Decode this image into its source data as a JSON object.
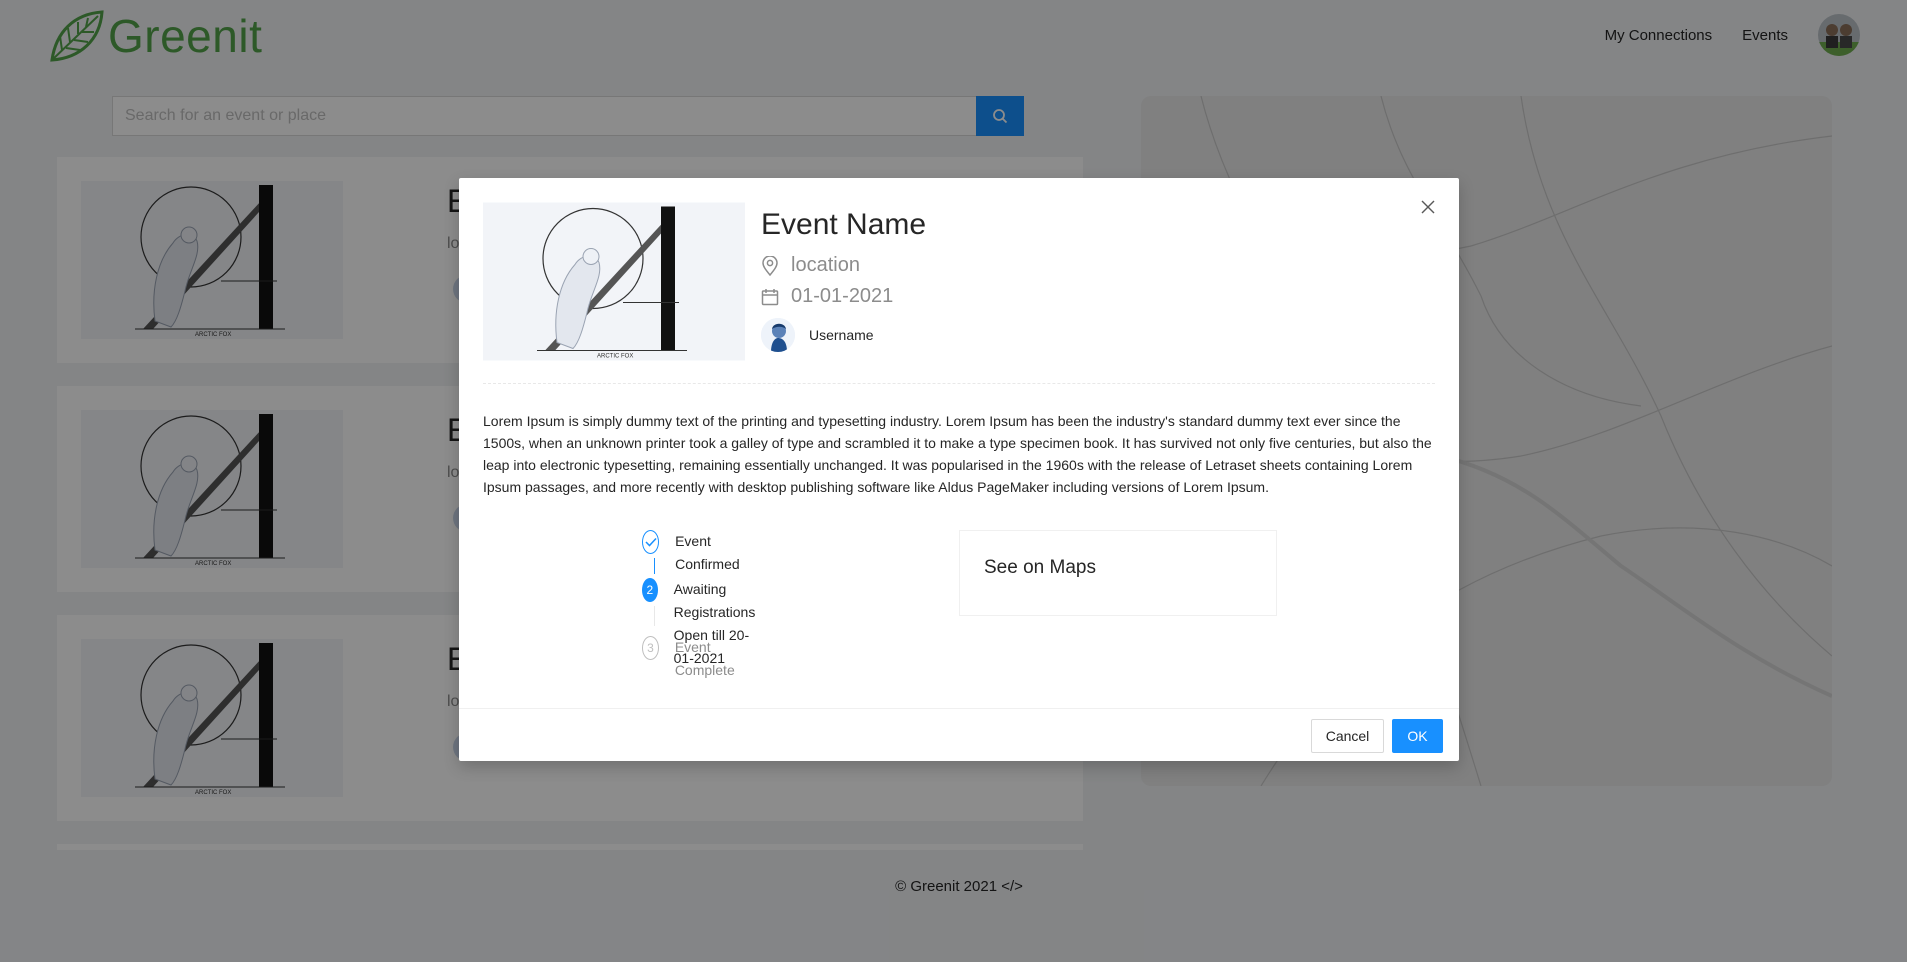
{
  "app": {
    "name": "Greenit"
  },
  "nav": {
    "connections": "My Connections",
    "events": "Events"
  },
  "search": {
    "placeholder": "Search for an event or place"
  },
  "poster": {
    "caption": "ARCTIC FOX"
  },
  "cards": [
    {
      "title": "E",
      "subtitle": "lo"
    },
    {
      "title": "E",
      "subtitle": "lo"
    },
    {
      "title": "E",
      "subtitle": "lo"
    }
  ],
  "footer": {
    "text": "© Greenit 2021 </>"
  },
  "modal": {
    "title": "Event Name",
    "location": "location",
    "date": "01-01-2021",
    "username": "Username",
    "description": "Lorem Ipsum is simply dummy text of the printing and typesetting industry. Lorem Ipsum has been the industry's standard dummy text ever since the 1500s, when an unknown printer took a galley of type and scrambled it to make a type specimen book. It has survived not only five centuries, but also the leap into electronic typesetting, remaining essentially unchanged. It was popularised in the 1960s with the release of Letraset sheets containing Lorem Ipsum passages, and more recently with desktop publishing software like Aldus PageMaker including versions of Lorem Ipsum.",
    "steps": [
      {
        "title": "Event Confirmed",
        "status": "finish",
        "icon": "check-icon"
      },
      {
        "number": "2",
        "title": "Awaiting Registrations",
        "description": "Open till 20-01-2021",
        "status": "process"
      },
      {
        "number": "3",
        "title": "Event Complete",
        "status": "wait"
      }
    ],
    "maps_label": "See on Maps",
    "cancel_label": "Cancel",
    "ok_label": "OK"
  },
  "colors": {
    "brand_green": "#52a34a",
    "primary_blue": "#1890ff"
  }
}
